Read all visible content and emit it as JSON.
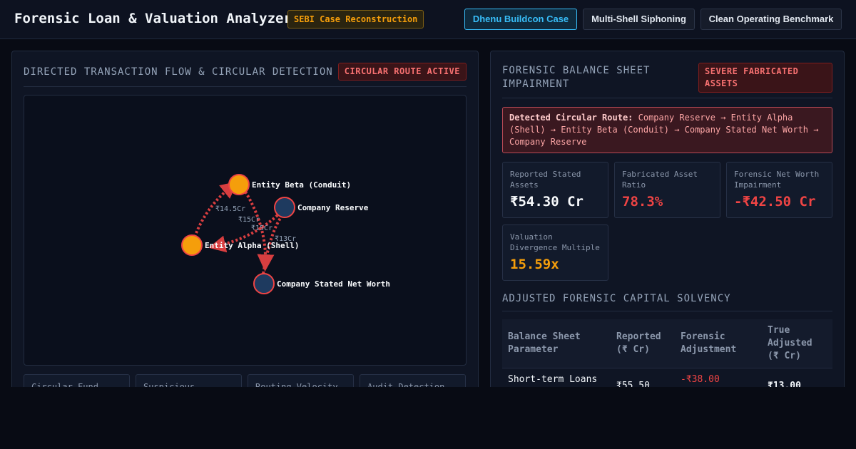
{
  "header": {
    "title": "Forensic Loan & Valuation Analyzer",
    "badge": "SEBI Case Reconstruction",
    "tabs": [
      {
        "label": "Dhenu Buildcon Case",
        "active": true
      },
      {
        "label": "Multi-Shell Siphoning",
        "active": false
      },
      {
        "label": "Clean Operating Benchmark",
        "active": false
      }
    ]
  },
  "flow_panel": {
    "title": "DIRECTED TRANSACTION FLOW & CIRCULAR DETECTION",
    "status": "CIRCULAR ROUTE ACTIVE",
    "nodes": [
      "Entity Beta (Conduit)",
      "Company Reserve",
      "Entity Alpha (Shell)",
      "Company Stated Net Worth"
    ],
    "edges": [
      {
        "from": "Entity Alpha (Shell)",
        "to": "Entity Beta (Conduit)",
        "label": "₹14.5Cr"
      },
      {
        "from": "Entity Beta (Conduit)",
        "to": "Company Stated Net Worth",
        "label": "₹15Cr"
      },
      {
        "from": "Company Reserve",
        "to": "Entity Alpha (Shell)",
        "label": "₹15Cr"
      },
      {
        "from": "Company Reserve",
        "to": "Company Stated Net Worth",
        "label": "₹13Cr"
      }
    ],
    "kpis": [
      "Circular Fund",
      "Suspicious",
      "Routing Velocity",
      "Audit Detection"
    ]
  },
  "valuation_panel": {
    "title": "FORENSIC BALANCE SHEET IMPAIRMENT",
    "status": "SEVERE FABRICATED ASSETS",
    "route_label": "Detected Circular Route:",
    "route_text": "Company Reserve → Entity Alpha (Shell) → Entity Beta (Conduit) → Company Stated Net Worth → Company Reserve",
    "stats": [
      {
        "label": "Reported Stated Assets",
        "value": "₹54.30 Cr",
        "color": "#f8fafc"
      },
      {
        "label": "Fabricated Asset Ratio",
        "value": "78.3%",
        "color": "#ef4444"
      },
      {
        "label": "Forensic Net Worth Impairment",
        "value": "-₹42.50 Cr",
        "color": "#ef4444"
      },
      {
        "label": "Valuation Divergence Multiple",
        "value": "15.59x",
        "color": "#f59e0b"
      }
    ],
    "solvency_title": "ADJUSTED FORENSIC CAPITAL SOLVENCY",
    "table": {
      "headers": [
        "Balance Sheet Parameter",
        "Reported (₹ Cr)",
        "Forensic Adjustment",
        "True Adjusted (₹ Cr)"
      ],
      "rows": [
        {
          "parameter": "Short-term Loans",
          "reported": "₹55.50",
          "adjustment": "-₹38.00",
          "adjusted": "₹13.00"
        }
      ]
    }
  },
  "colors": {
    "accent": "#38bdf8",
    "warning": "#f59e0b",
    "danger": "#ef4444",
    "node_shell": "#f59e0b",
    "node_company": "#1e3a5f"
  }
}
